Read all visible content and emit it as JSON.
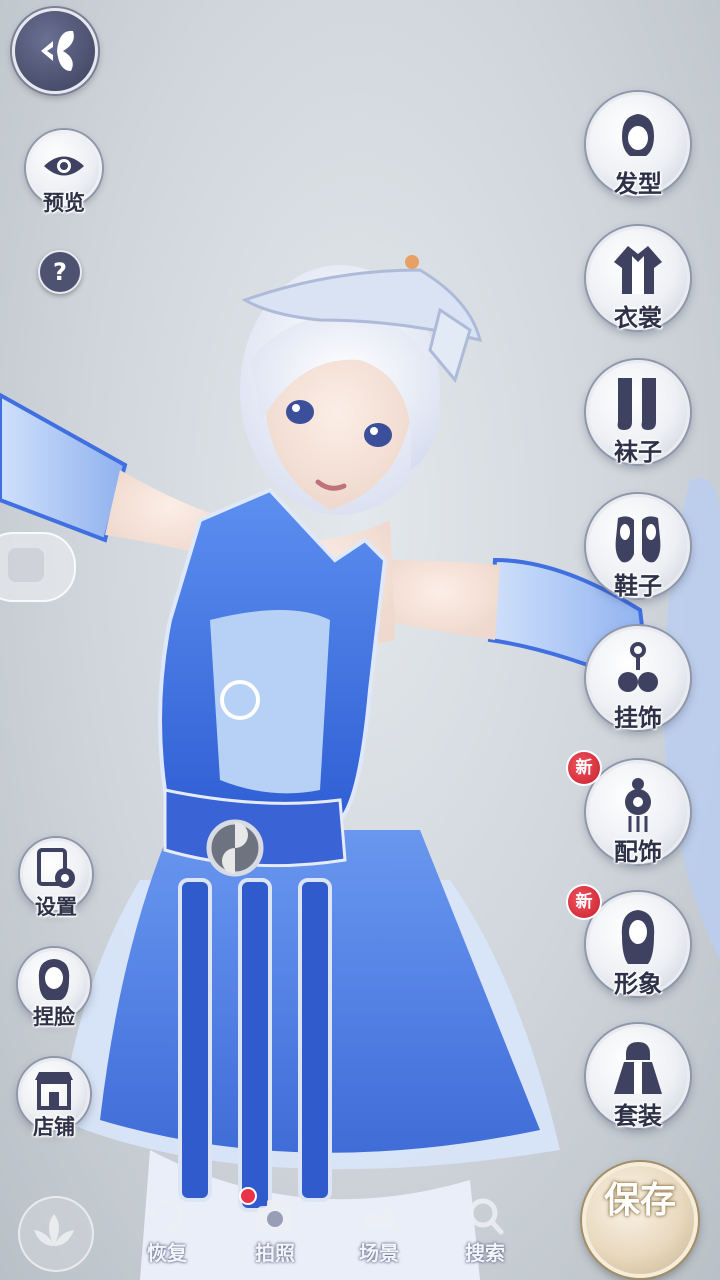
{
  "top": {
    "back_icon": "back-butterfly-icon",
    "preview_label": "预览",
    "help_text": "?"
  },
  "right_menu": [
    {
      "label": "发型",
      "icon": "hairstyle-icon",
      "is_new": false
    },
    {
      "label": "衣裳",
      "icon": "clothing-icon",
      "is_new": false
    },
    {
      "label": "袜子",
      "icon": "socks-icon",
      "is_new": false
    },
    {
      "label": "鞋子",
      "icon": "shoes-icon",
      "is_new": false
    },
    {
      "label": "挂饰",
      "icon": "pendant-icon",
      "is_new": false
    },
    {
      "label": "配饰",
      "icon": "accessory-icon",
      "is_new": true
    },
    {
      "label": "形象",
      "icon": "appearance-icon",
      "is_new": true
    },
    {
      "label": "套装",
      "icon": "outfit-set-icon",
      "is_new": false
    }
  ],
  "badge_text": "新",
  "left_menu": [
    {
      "label": "设置",
      "icon": "settings-icon"
    },
    {
      "label": "捏脸",
      "icon": "face-edit-icon"
    },
    {
      "label": "店铺",
      "icon": "shop-icon"
    }
  ],
  "bottom_bar": {
    "restore_label": "恢复",
    "photo_label": "拍照",
    "scene_label": "场景",
    "search_label": "搜索"
  },
  "save_label": "保存",
  "colors": {
    "dress_blue": "#3d6fe0",
    "dress_light": "#a9c6f5",
    "button_dark": "#4a4f6d",
    "badge_red": "#d8263a",
    "save_gold": "#e8d9bf"
  }
}
